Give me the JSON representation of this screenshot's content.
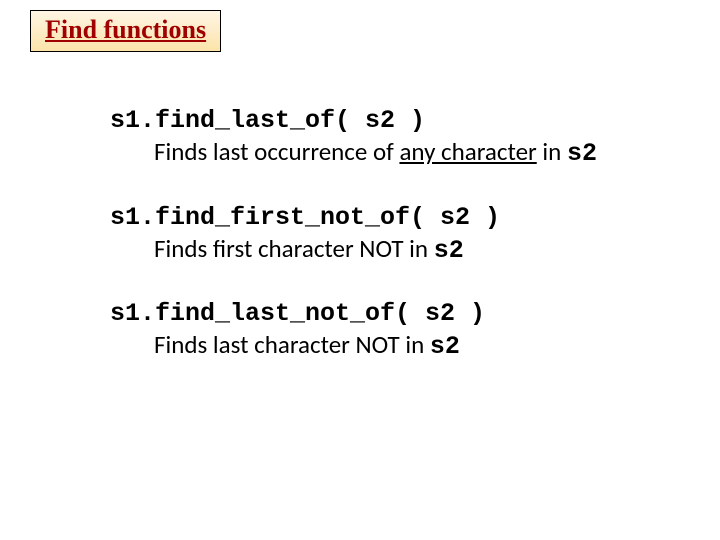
{
  "title": "Find functions",
  "items": [
    {
      "code": "s1.find_last_of( s2 )",
      "desc_pre": "Finds last occurrence of ",
      "desc_underlined": "any character",
      "desc_post": " in ",
      "desc_code": "s2"
    },
    {
      "code": "s1.find_first_not_of( s2 )",
      "desc_pre": "Finds first character NOT in ",
      "desc_underlined": "",
      "desc_post": "",
      "desc_code": "s2"
    },
    {
      "code": "s1.find_last_not_of( s2 )",
      "desc_pre": "Finds last character NOT in ",
      "desc_underlined": "",
      "desc_post": "",
      "desc_code": "s2"
    }
  ]
}
